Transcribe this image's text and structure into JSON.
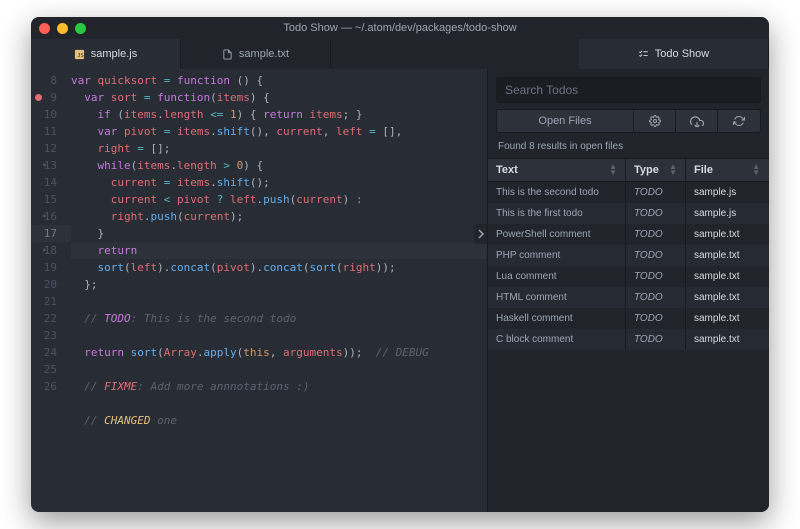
{
  "window_title": "Todo Show — ~/.atom/dev/packages/todo-show",
  "tabs": {
    "left": {
      "label": "sample.js",
      "icon_color": "#e5c07b"
    },
    "middle": {
      "label": "sample.txt"
    },
    "right": {
      "label": "Todo Show"
    }
  },
  "gutter": [
    "8",
    "9",
    "10",
    "11",
    "12",
    "·",
    "13",
    "14",
    "15",
    "·",
    "16",
    "17",
    "·",
    "18",
    "19",
    "20",
    "21",
    "22",
    "23",
    "24",
    "25",
    "26"
  ],
  "highlight_index": 11,
  "breakpoint_index": 1,
  "code_lines": [
    [
      ""
    ],
    [
      {
        "c": "c-kw",
        "t": "var"
      },
      {
        "t": " "
      },
      {
        "c": "c-id",
        "t": "quicksort"
      },
      {
        "t": " "
      },
      {
        "c": "c-op",
        "t": "="
      },
      {
        "t": " "
      },
      {
        "c": "c-kw",
        "t": "function"
      },
      {
        "t": " "
      },
      {
        "c": "c-pn",
        "t": "() {"
      }
    ],
    [
      {
        "t": "  "
      },
      {
        "c": "c-kw",
        "t": "var"
      },
      {
        "t": " "
      },
      {
        "c": "c-id",
        "t": "sort"
      },
      {
        "t": " "
      },
      {
        "c": "c-op",
        "t": "="
      },
      {
        "t": " "
      },
      {
        "c": "c-kw",
        "t": "function"
      },
      {
        "c": "c-pn",
        "t": "("
      },
      {
        "c": "c-id",
        "t": "items"
      },
      {
        "c": "c-pn",
        "t": ") {"
      }
    ],
    [
      {
        "t": "    "
      },
      {
        "c": "c-kw",
        "t": "if"
      },
      {
        "t": " "
      },
      {
        "c": "c-pn",
        "t": "("
      },
      {
        "c": "c-id",
        "t": "items"
      },
      {
        "c": "c-pn",
        "t": "."
      },
      {
        "c": "c-id",
        "t": "length"
      },
      {
        "t": " "
      },
      {
        "c": "c-op",
        "t": "<="
      },
      {
        "t": " "
      },
      {
        "c": "c-num",
        "t": "1"
      },
      {
        "c": "c-pn",
        "t": ") { "
      },
      {
        "c": "c-kw",
        "t": "return"
      },
      {
        "t": " "
      },
      {
        "c": "c-id",
        "t": "items"
      },
      {
        "c": "c-pn",
        "t": "; }"
      }
    ],
    [
      {
        "t": "    "
      },
      {
        "c": "c-kw",
        "t": "var"
      },
      {
        "t": " "
      },
      {
        "c": "c-id",
        "t": "pivot"
      },
      {
        "t": " "
      },
      {
        "c": "c-op",
        "t": "="
      },
      {
        "t": " "
      },
      {
        "c": "c-id",
        "t": "items"
      },
      {
        "c": "c-pn",
        "t": "."
      },
      {
        "c": "c-fn",
        "t": "shift"
      },
      {
        "c": "c-pn",
        "t": "(), "
      },
      {
        "c": "c-id",
        "t": "current"
      },
      {
        "c": "c-pn",
        "t": ", "
      },
      {
        "c": "c-id",
        "t": "left"
      },
      {
        "t": " "
      },
      {
        "c": "c-op",
        "t": "="
      },
      {
        "t": " "
      },
      {
        "c": "c-pn",
        "t": "[],"
      }
    ],
    [
      {
        "t": "    "
      },
      {
        "c": "c-id",
        "t": "right"
      },
      {
        "t": " "
      },
      {
        "c": "c-op",
        "t": "="
      },
      {
        "t": " "
      },
      {
        "c": "c-pn",
        "t": "[];"
      }
    ],
    [
      {
        "t": "    "
      },
      {
        "c": "c-kw",
        "t": "while"
      },
      {
        "c": "c-pn",
        "t": "("
      },
      {
        "c": "c-id",
        "t": "items"
      },
      {
        "c": "c-pn",
        "t": "."
      },
      {
        "c": "c-id",
        "t": "length"
      },
      {
        "t": " "
      },
      {
        "c": "c-op",
        "t": ">"
      },
      {
        "t": " "
      },
      {
        "c": "c-num",
        "t": "0"
      },
      {
        "c": "c-pn",
        "t": ") {"
      }
    ],
    [
      {
        "t": "      "
      },
      {
        "c": "c-id",
        "t": "current"
      },
      {
        "t": " "
      },
      {
        "c": "c-op",
        "t": "="
      },
      {
        "t": " "
      },
      {
        "c": "c-id",
        "t": "items"
      },
      {
        "c": "c-pn",
        "t": "."
      },
      {
        "c": "c-fn",
        "t": "shift"
      },
      {
        "c": "c-pn",
        "t": "();"
      }
    ],
    [
      {
        "t": "      "
      },
      {
        "c": "c-id",
        "t": "current"
      },
      {
        "t": " "
      },
      {
        "c": "c-op",
        "t": "<"
      },
      {
        "t": " "
      },
      {
        "c": "c-id",
        "t": "pivot"
      },
      {
        "t": " "
      },
      {
        "c": "c-op",
        "t": "?"
      },
      {
        "t": " "
      },
      {
        "c": "c-id",
        "t": "left"
      },
      {
        "c": "c-pn",
        "t": "."
      },
      {
        "c": "c-fn",
        "t": "push"
      },
      {
        "c": "c-pn",
        "t": "("
      },
      {
        "c": "c-id",
        "t": "current"
      },
      {
        "c": "c-pn",
        "t": ") "
      },
      {
        "c": "c-op",
        "t": ":"
      }
    ],
    [
      {
        "t": "      "
      },
      {
        "c": "c-id",
        "t": "right"
      },
      {
        "c": "c-pn",
        "t": "."
      },
      {
        "c": "c-fn",
        "t": "push"
      },
      {
        "c": "c-pn",
        "t": "("
      },
      {
        "c": "c-id",
        "t": "current"
      },
      {
        "c": "c-pn",
        "t": ");"
      }
    ],
    [
      {
        "t": "    "
      },
      {
        "c": "c-pn",
        "t": "}"
      }
    ],
    [
      {
        "t": "    "
      },
      {
        "c": "c-kw",
        "t": "return"
      }
    ],
    [
      {
        "t": "    "
      },
      {
        "c": "c-fn",
        "t": "sort"
      },
      {
        "c": "c-pn",
        "t": "("
      },
      {
        "c": "c-id",
        "t": "left"
      },
      {
        "c": "c-pn",
        "t": ")."
      },
      {
        "c": "c-fn",
        "t": "concat"
      },
      {
        "c": "c-pn",
        "t": "("
      },
      {
        "c": "c-id",
        "t": "pivot"
      },
      {
        "c": "c-pn",
        "t": ")."
      },
      {
        "c": "c-fn",
        "t": "concat"
      },
      {
        "c": "c-pn",
        "t": "("
      },
      {
        "c": "c-fn",
        "t": "sort"
      },
      {
        "c": "c-pn",
        "t": "("
      },
      {
        "c": "c-id",
        "t": "right"
      },
      {
        "c": "c-pn",
        "t": "));"
      }
    ],
    [
      {
        "t": "  "
      },
      {
        "c": "c-pn",
        "t": "};"
      }
    ],
    [
      {
        "t": ""
      }
    ],
    [
      {
        "t": "  "
      },
      {
        "c": "c-cm",
        "t": "// "
      },
      {
        "c": "c-tag",
        "t": "TODO"
      },
      {
        "c": "c-cm",
        "t": ": This is the second todo"
      }
    ],
    [
      {
        "t": ""
      }
    ],
    [
      {
        "t": "  "
      },
      {
        "c": "c-kw",
        "t": "return"
      },
      {
        "t": " "
      },
      {
        "c": "c-fn",
        "t": "sort"
      },
      {
        "c": "c-pn",
        "t": "("
      },
      {
        "c": "c-id",
        "t": "Array"
      },
      {
        "c": "c-pn",
        "t": "."
      },
      {
        "c": "c-fn",
        "t": "apply"
      },
      {
        "c": "c-pn",
        "t": "("
      },
      {
        "c": "c-num",
        "t": "this"
      },
      {
        "c": "c-pn",
        "t": ", "
      },
      {
        "c": "c-id",
        "t": "arguments"
      },
      {
        "c": "c-pn",
        "t": "));  "
      },
      {
        "c": "c-cm",
        "t": "// DEBUG"
      }
    ],
    [
      {
        "t": ""
      }
    ],
    [
      {
        "t": "  "
      },
      {
        "c": "c-cm",
        "t": "// "
      },
      {
        "c": "c-tag3",
        "t": "FIXME"
      },
      {
        "c": "c-cm",
        "t": ": Add more annnotations :)"
      }
    ],
    [
      {
        "t": ""
      }
    ],
    [
      {
        "t": "  "
      },
      {
        "c": "c-cm",
        "t": "// "
      },
      {
        "c": "c-tag2",
        "t": "CHANGED"
      },
      {
        "c": "c-cm",
        "t": " one"
      }
    ]
  ],
  "panel": {
    "search_placeholder": "Search Todos",
    "open_files_label": "Open Files",
    "results_text": "Found 8 results in open files",
    "columns": {
      "text": "Text",
      "type": "Type",
      "file": "File"
    },
    "rows": [
      {
        "text": "This is the second todo",
        "type": "TODO",
        "file": "sample.js"
      },
      {
        "text": "This is the first todo",
        "type": "TODO",
        "file": "sample.js"
      },
      {
        "text": "PowerShell comment",
        "type": "TODO",
        "file": "sample.txt"
      },
      {
        "text": "PHP comment",
        "type": "TODO",
        "file": "sample.txt"
      },
      {
        "text": "Lua comment",
        "type": "TODO",
        "file": "sample.txt"
      },
      {
        "text": "HTML comment",
        "type": "TODO",
        "file": "sample.txt"
      },
      {
        "text": "Haskell comment",
        "type": "TODO",
        "file": "sample.txt"
      },
      {
        "text": "C block comment",
        "type": "TODO",
        "file": "sample.txt"
      }
    ]
  }
}
